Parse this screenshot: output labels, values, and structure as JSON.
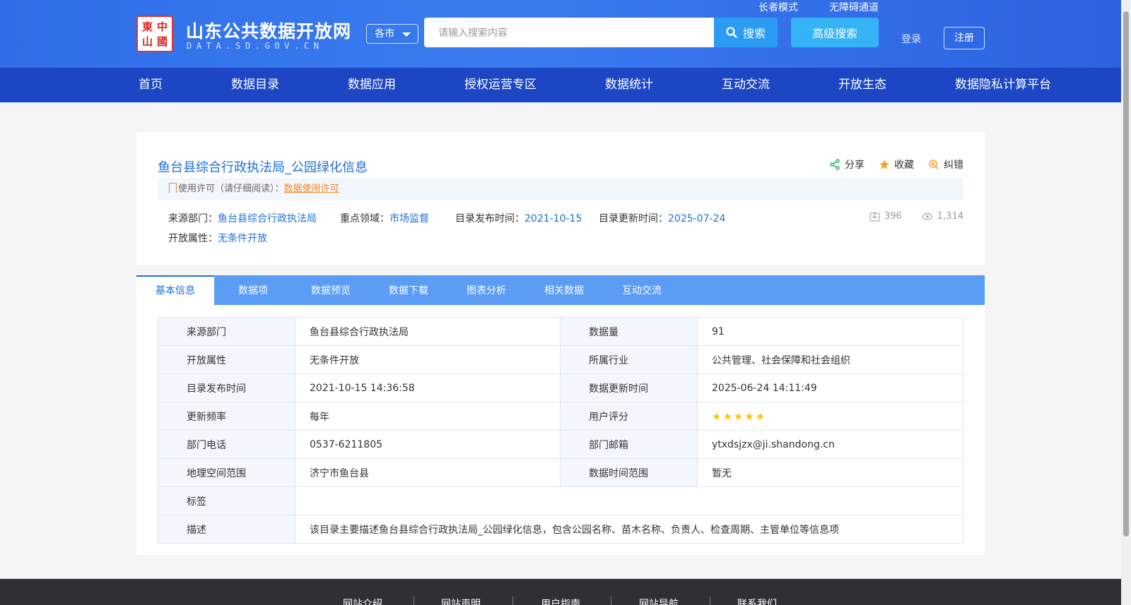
{
  "header": {
    "site_title": "山东公共数据开放网",
    "site_subtitle": "DATA.SD.GOV.CN",
    "seal_chars": [
      "中",
      "國",
      "山",
      "東"
    ],
    "city_select": "各市",
    "search_placeholder": "请输入搜索内容",
    "search_label": "搜索",
    "advanced_search_label": "高级搜索",
    "elder_mode": "长者模式",
    "accessibility": "无障碍通道",
    "login": "登录",
    "register": "注册"
  },
  "nav": [
    "首页",
    "数据目录",
    "数据应用",
    "授权运营专区",
    "数据统计",
    "互动交流",
    "开放生态",
    "数据隐私计算平台"
  ],
  "dataset": {
    "title": "鱼台县综合行政执法局_公园绿化信息",
    "actions": {
      "share": "分享",
      "favorite": "收藏",
      "correct": "纠错"
    },
    "license_label": "使用许可（请仔细阅读）：",
    "license_link": "数据使用许可",
    "source_label": "来源部门：",
    "source_value": "鱼台县综合行政执法局",
    "field_label": "重点领域：",
    "field_value": "市场监督",
    "publish_label": "目录发布时间：",
    "publish_value": "2021-10-15",
    "update_label": "目录更新时间：",
    "update_value": "2025-07-24",
    "open_label": "开放属性：",
    "open_value": "无条件开放",
    "downloads": "396",
    "views": "1,314"
  },
  "tabs": [
    "基本信息",
    "数据项",
    "数据预览",
    "数据下载",
    "图表分析",
    "相关数据",
    "互动交流"
  ],
  "info_table": {
    "rows": [
      [
        "来源部门",
        "鱼台县综合行政执法局",
        "数据量",
        "91"
      ],
      [
        "开放属性",
        "无条件开放",
        "所属行业",
        "公共管理、社会保障和社会组织"
      ],
      [
        "目录发布时间",
        "2021-10-15 14:36:58",
        "数据更新时间",
        "2025-06-24 14:11:49"
      ],
      [
        "更新频率",
        "每年",
        "用户评分",
        ""
      ],
      [
        "部门电话",
        "0537-6211805",
        "部门邮箱",
        "ytxdsjzx@ji.shandong.cn"
      ],
      [
        "地理空间范围",
        "济宁市鱼台县",
        "数据时间范围",
        "暂无"
      ]
    ],
    "rating": 5,
    "tags_label": "标签",
    "tags_value": "",
    "desc_label": "描述",
    "desc_value": "该目录主要描述鱼台县综合行政执法局_公园绿化信息，包含公园名称、苗木名称、负责人、检查周期、主管单位等信息项"
  },
  "footer": [
    "网站介绍",
    "网站声明",
    "用户指南",
    "网站导航",
    "联系我们"
  ],
  "colors": {
    "primary": "#1d6fd8",
    "nav": "#1c46c4",
    "accent": "#f08a24",
    "star": "#ffc400"
  }
}
